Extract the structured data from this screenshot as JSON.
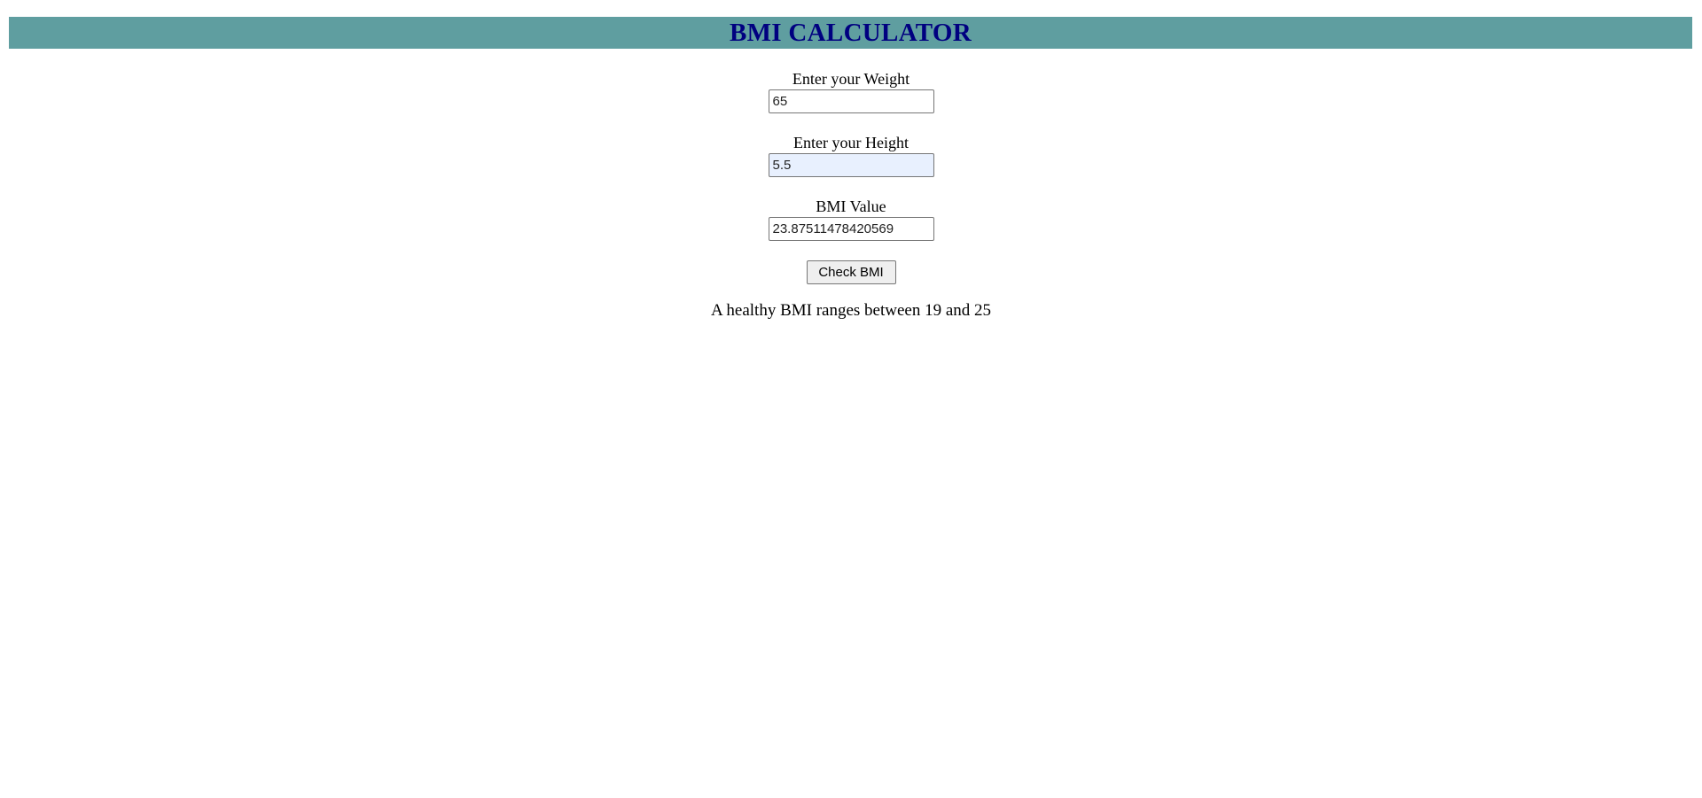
{
  "header": {
    "title": "BMI CALCULATOR"
  },
  "colors": {
    "header_background": "#5f9ea0",
    "title_text": "#000080",
    "autofill_field_background": "#e8f0fe"
  },
  "form": {
    "weight": {
      "label": "Enter your Weight",
      "value": "65"
    },
    "height": {
      "label": "Enter your Height",
      "value": "5.5"
    },
    "bmi": {
      "label": "BMI Value",
      "value": "23.87511478420569"
    },
    "check_button_label": "Check BMI"
  },
  "info": {
    "healthy_range_text": "A healthy BMI ranges between 19 and 25"
  }
}
